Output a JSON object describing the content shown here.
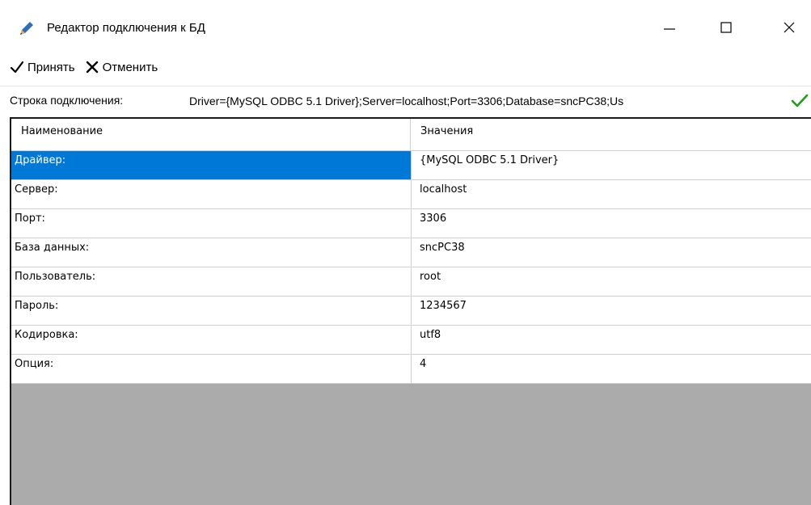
{
  "window": {
    "title": "Редактор подключения к БД",
    "icons": {
      "app": "pencil-icon",
      "minimize": "minimize-icon",
      "maximize": "maximize-icon",
      "close": "close-icon"
    }
  },
  "toolbar": {
    "accept_label": "Принять",
    "cancel_label": "Отменить",
    "accept_icon": "checkmark-icon",
    "cancel_icon": "cross-icon"
  },
  "connection": {
    "label": "Строка подключения:",
    "value": "Driver={MySQL ODBC 5.1 Driver};Server=localhost;Port=3306;Database=sncPC38;Us",
    "apply_icon": "green-check-icon"
  },
  "grid": {
    "headers": [
      "Наименование",
      "Значения"
    ],
    "rows": [
      {
        "name": "Драйвер:",
        "value": "{MySQL ODBC 5.1 Driver}",
        "selected": true
      },
      {
        "name": "Сервер:",
        "value": "localhost"
      },
      {
        "name": "Порт:",
        "value": "3306"
      },
      {
        "name": "База данных:",
        "value": "sncPC38"
      },
      {
        "name": "Пользователь:",
        "value": "root"
      },
      {
        "name": "Пароль:",
        "value": "1234567"
      },
      {
        "name": "Кодировка:",
        "value": "utf8"
      },
      {
        "name": "Опция:",
        "value": "4"
      }
    ]
  },
  "colors": {
    "selection": "#0078d7",
    "grid_empty_background": "#ababab",
    "ok_green": "#1e9e1e"
  }
}
